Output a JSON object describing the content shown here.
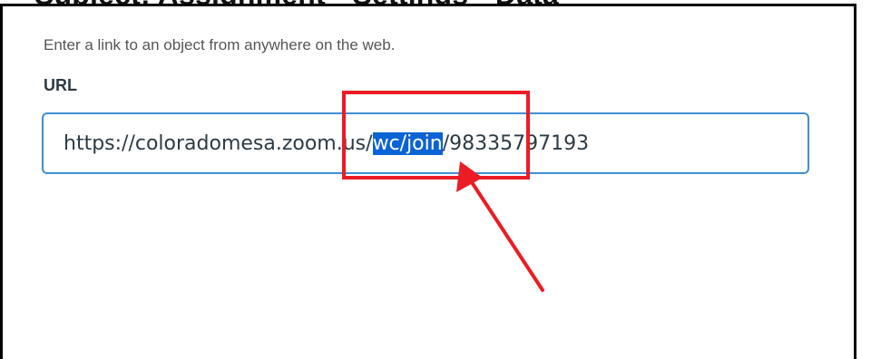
{
  "header": {
    "cut_text": "Subject: Assignment • Settings • Data"
  },
  "dialog": {
    "description": "Enter a link to an object from anywhere on the web.",
    "url_label": "URL",
    "url_input": {
      "value_before": "https://coloradomesa.zoom.us/",
      "value_selected": "wc/join",
      "value_after": "/98335797193",
      "full_value": "https://coloradomesa.zoom.us/wc/join/98335797193"
    }
  },
  "annotation": {
    "color": "#ec1c24",
    "type": "highlight-box-with-arrow"
  },
  "colors": {
    "input_border": "#3d8fd6",
    "selection": "#0b63d4",
    "label_text": "#2d3b45",
    "description_text": "#555555"
  }
}
